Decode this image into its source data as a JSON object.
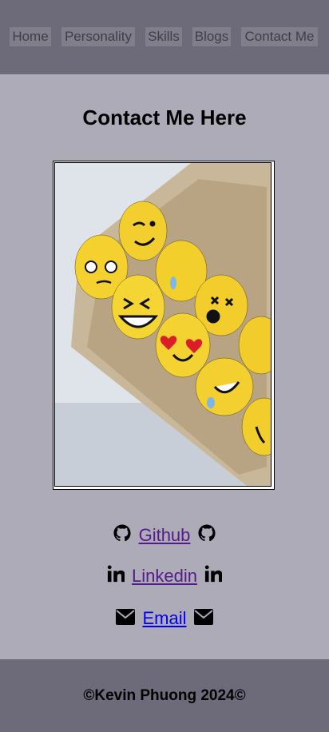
{
  "nav": {
    "items": [
      {
        "label": "Home"
      },
      {
        "label": "Personality"
      },
      {
        "label": "Skills"
      },
      {
        "label": "Blogs"
      },
      {
        "label": "Contact Me"
      }
    ]
  },
  "main": {
    "title": "Contact Me Here",
    "links": {
      "github": "Github",
      "linkedin": "Linkedin",
      "email": "Email"
    }
  },
  "footer": {
    "text": "©Kevin Phuong 2024©"
  },
  "colors": {
    "background": "#aeabb9",
    "nav_bg": "#6d6a79",
    "visited_link": "#551a8b",
    "link": "#0000ee"
  },
  "icons": [
    "github-icon",
    "linkedin-icon",
    "envelope-icon"
  ]
}
